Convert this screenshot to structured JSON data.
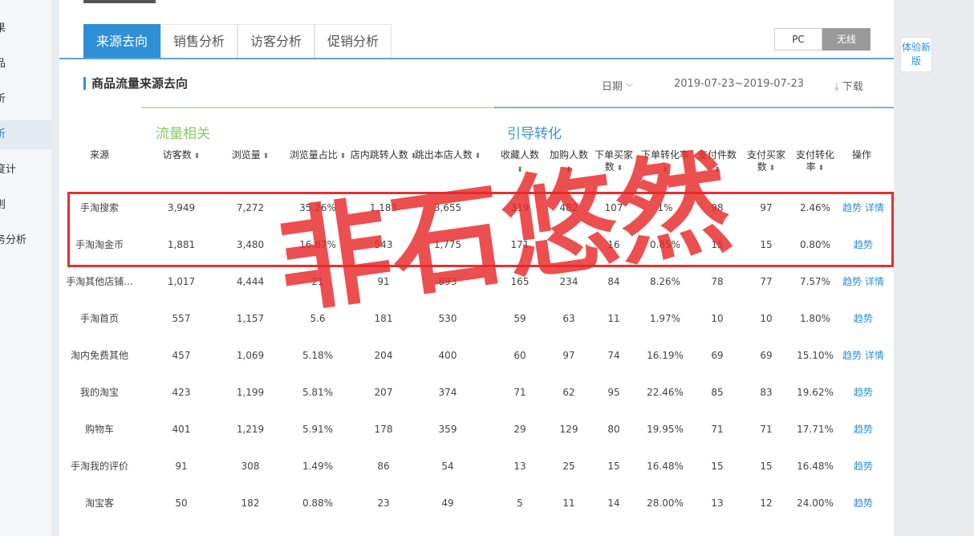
{
  "sidebar": {
    "items": [
      "果",
      "品",
      "析",
      "析",
      "度计",
      "则",
      "务分析"
    ]
  },
  "tabs": [
    "来源去向",
    "销售分析",
    "访客分析",
    "促销分析"
  ],
  "device_toggle": {
    "pc": "PC",
    "wireless": "无线"
  },
  "section_title": "商品流量来源去向",
  "date_label": "日期",
  "date_range": "2019-07-23~2019-07-23",
  "download": "下载",
  "groups": {
    "traffic": "流量相关",
    "conversion": "引导转化"
  },
  "columns": [
    "来源",
    "访客数",
    "浏览量",
    "浏览量占比",
    "店内跳转人数",
    "跳出本店人数",
    "收藏人数",
    "加购人数",
    "下单买家数",
    "下单转化率",
    "支付件数",
    "支付买家数",
    "支付转化率",
    "操作"
  ],
  "rows": [
    [
      "手淘搜索",
      "3,949",
      "7,272",
      "35.26%",
      "1,183",
      "3,655",
      "319",
      "482",
      "107",
      "1%",
      "98",
      "97",
      "2.46%"
    ],
    [
      "手淘淘金币",
      "1,881",
      "3,480",
      "16.87%",
      "543",
      "1,775",
      "171",
      "",
      "16",
      "0.85%",
      "15",
      "15",
      "0.80%"
    ],
    [
      "手淘其他店铺...",
      "1,017",
      "4,444",
      "21",
      "91",
      "893",
      "165",
      "234",
      "84",
      "8.26%",
      "78",
      "77",
      "7.57%"
    ],
    [
      "手淘首页",
      "557",
      "1,157",
      "5.6",
      "181",
      "530",
      "59",
      "63",
      "11",
      "1.97%",
      "10",
      "10",
      "1.80%"
    ],
    [
      "淘内免费其他",
      "457",
      "1,069",
      "5.18%",
      "204",
      "400",
      "60",
      "97",
      "74",
      "16.19%",
      "69",
      "69",
      "15.10%"
    ],
    [
      "我的淘宝",
      "423",
      "1,199",
      "5.81%",
      "207",
      "374",
      "71",
      "62",
      "95",
      "22.46%",
      "85",
      "83",
      "19.62%"
    ],
    [
      "购物车",
      "401",
      "1,219",
      "5.91%",
      "178",
      "359",
      "29",
      "129",
      "80",
      "19.95%",
      "71",
      "71",
      "17.71%"
    ],
    [
      "手淘我的评价",
      "91",
      "308",
      "1.49%",
      "86",
      "54",
      "13",
      "25",
      "15",
      "16.48%",
      "15",
      "15",
      "16.48%"
    ],
    [
      "淘宝客",
      "50",
      "182",
      "0.88%",
      "23",
      "49",
      "5",
      "11",
      "14",
      "28.00%",
      "13",
      "12",
      "24.00%"
    ]
  ],
  "actions": {
    "trend": "趋势",
    "detail": "详情"
  },
  "watermark": "非石悠然",
  "badge": "体验新版"
}
